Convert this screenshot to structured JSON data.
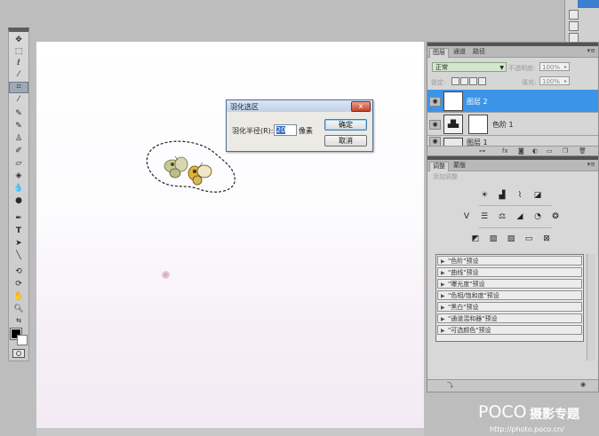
{
  "dialog": {
    "title": "羽化选区",
    "close_glyph": "x",
    "radius_label": "羽化半径(R):",
    "radius_value": "20",
    "unit": "像素",
    "ok_label": "确定",
    "cancel_label": "取消"
  },
  "layers_panel": {
    "tabs": [
      "图层",
      "通道",
      "路径"
    ],
    "blend_mode": "正常",
    "opacity_label": "不透明度:",
    "opacity_value": "100%",
    "lock_label": "锁定:",
    "fill_label": "填充:",
    "fill_value": "100%",
    "layers": [
      {
        "name": "图层 2",
        "selected": true
      },
      {
        "name": "色阶 1",
        "selected": false
      },
      {
        "name": "图层 1",
        "selected": false
      }
    ]
  },
  "adjust_panel": {
    "tabs": [
      "调整",
      "蒙版"
    ],
    "add_adjustment_label": "添加调整",
    "presets": [
      "\"色阶\"预设",
      "\"曲线\"预设",
      "\"曝光度\"预设",
      "\"色相/饱和度\"预设",
      "\"黑白\"预设",
      "\"通道混和器\"预设",
      "\"可选颜色\"预设"
    ]
  },
  "watermark": {
    "brand": "POCO",
    "brand_cn": "摄影专题",
    "url": "http://photo.poco.cn/"
  },
  "icons": [
    "move-icon",
    "marquee-icon",
    "lasso-icon",
    "magic-wand-icon",
    "crop-icon",
    "eyedropper-icon",
    "healing-icon",
    "brush-icon",
    "stamp-icon",
    "history-brush-icon",
    "eraser-icon",
    "bucket-icon",
    "blur-icon",
    "dodge-icon",
    "pen-icon",
    "type-icon",
    "path-select-icon",
    "line-icon",
    "3d-rotate-icon",
    "3d-orbit-icon",
    "hand-icon",
    "zoom-icon"
  ]
}
